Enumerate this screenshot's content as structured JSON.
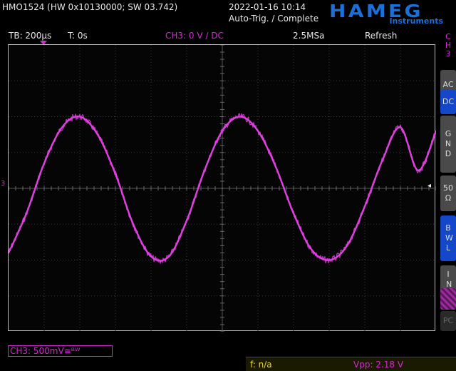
{
  "header": {
    "model": "HMO1524 (HW 0x10130000; SW 03.742)",
    "datetime": "2022-01-16 10:14",
    "trigger_status": "Auto-Trig. / Complete",
    "logo": "HAMEG",
    "logo_sub": "Instruments"
  },
  "info": {
    "timebase": "TB: 200µs",
    "trigger_time": "T: 0s",
    "channel_setting": "CH3: 0 V ∕ DC",
    "sample_rate": "2.5MSa",
    "mode": "Refresh"
  },
  "side_menu": {
    "channel": [
      "C",
      "H",
      "3"
    ],
    "buttons": [
      {
        "label": "AC",
        "state": "off"
      },
      {
        "label": "DC",
        "state": "on"
      },
      {
        "label": "G N D",
        "state": "off"
      },
      {
        "label": "50 Ω",
        "state": "off"
      },
      {
        "label": "B W L",
        "state": "on"
      },
      {
        "label": "I N V",
        "state": "off"
      },
      {
        "label": "",
        "state": "hatched"
      },
      {
        "label": "PC",
        "state": "disabled"
      }
    ]
  },
  "channel_box": "CH3: 500mV≅ᴮᵂ",
  "measurements": {
    "frequency": "f: n/a",
    "vpp": "Vpp: 2.18 V"
  },
  "markers": {
    "left_channel": "3",
    "trigger_level": "◂"
  },
  "colors": {
    "trace": "#e040e0",
    "accent_blue": "#1d6fd8",
    "channel": "#d42ad4",
    "measure": "#e8d83a"
  },
  "chart_data": {
    "type": "line",
    "title": "",
    "xlabel": "",
    "ylabel": "",
    "x_unit": "µs",
    "y_unit": "V",
    "xlim": [
      -1200,
      1200
    ],
    "ylim": [
      -2,
      2
    ],
    "grid": true,
    "series": [
      {
        "x": [
          -1200,
          -1100,
          -1000,
          -900,
          -800,
          -700,
          -600,
          -500,
          -400,
          -300,
          -200,
          -100,
          0,
          100,
          200,
          300,
          400,
          500,
          600,
          700,
          800,
          900,
          1000,
          1100,
          1200
        ],
        "values": [
          -0.9,
          -0.35,
          0.35,
          0.85,
          1.0,
          0.75,
          0.2,
          -0.5,
          -0.95,
          -0.95,
          -0.45,
          0.25,
          0.8,
          1.0,
          0.8,
          0.3,
          -0.35,
          -0.85,
          -1.0,
          -0.8,
          -0.25,
          0.4,
          0.85,
          0.25,
          0.8
        ]
      }
    ]
  }
}
